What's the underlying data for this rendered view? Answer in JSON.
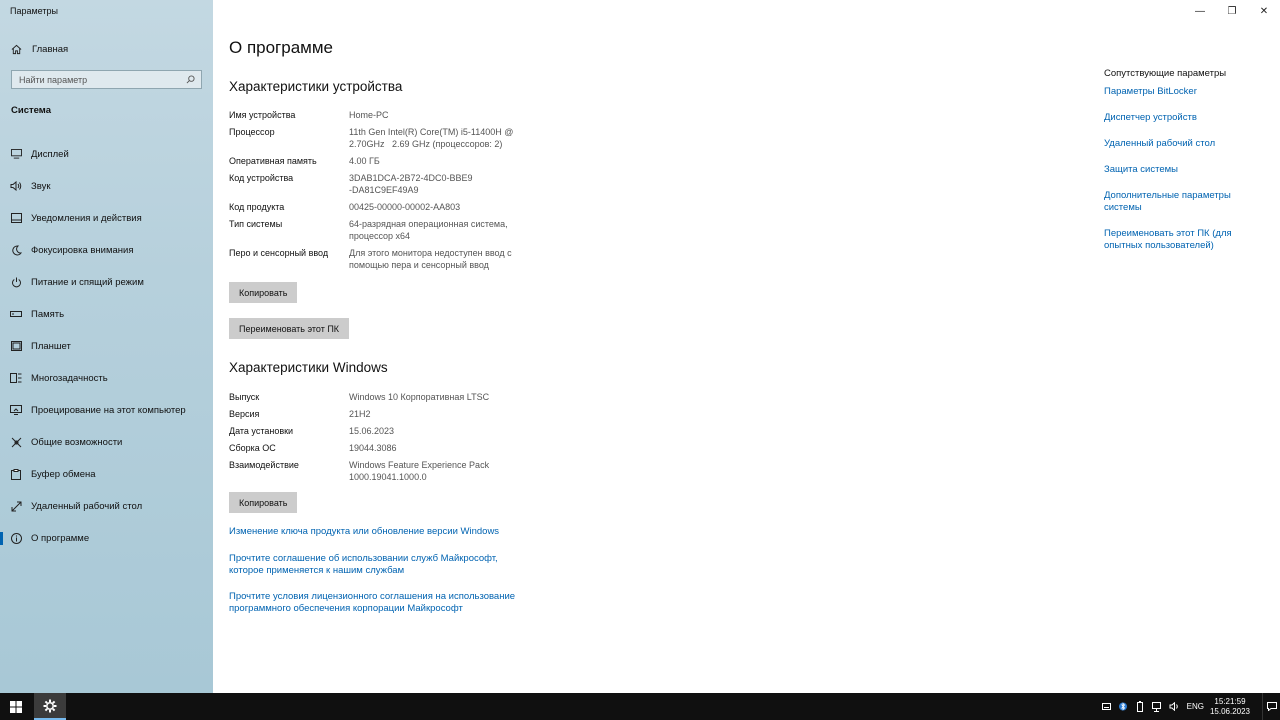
{
  "window": {
    "title": "Параметры",
    "minimize_glyph": "—",
    "restore_glyph": "❐",
    "close_glyph": "✕"
  },
  "sidebar": {
    "home_label": "Главная",
    "search_placeholder": "Найти параметр",
    "section_label": "Система",
    "items": [
      {
        "label": "Дисплей",
        "icon": "display-icon"
      },
      {
        "label": "Звук",
        "icon": "speaker-icon"
      },
      {
        "label": "Уведомления и действия",
        "icon": "notifications-icon"
      },
      {
        "label": "Фокусировка внимания",
        "icon": "moon-icon"
      },
      {
        "label": "Питание и спящий режим",
        "icon": "power-icon"
      },
      {
        "label": "Память",
        "icon": "storage-icon"
      },
      {
        "label": "Планшет",
        "icon": "tablet-icon"
      },
      {
        "label": "Многозадачность",
        "icon": "multitasking-icon"
      },
      {
        "label": "Проецирование на этот компьютер",
        "icon": "projecting-icon"
      },
      {
        "label": "Общие возможности",
        "icon": "shared-experiences-icon"
      },
      {
        "label": "Буфер обмена",
        "icon": "clipboard-icon"
      },
      {
        "label": "Удаленный рабочий стол",
        "icon": "remote-desktop-icon"
      },
      {
        "label": "О программе",
        "icon": "info-icon",
        "active": true
      }
    ]
  },
  "main": {
    "page_title": "О программе",
    "device_specs": {
      "heading": "Характеристики устройства",
      "rows": [
        {
          "key": "Имя устройства",
          "value": "Home-PC"
        },
        {
          "key": "Процессор",
          "value": "11th Gen Intel(R) Core(TM) i5-11400H @ 2.70GHz   2.69 GHz (процессоров: 2)"
        },
        {
          "key": "Оперативная память",
          "value": "4.00 ГБ"
        },
        {
          "key": "Код устройства",
          "value": "3DAB1DCA-2B72-4DC0-BBE9-DA81C9EF49A9"
        },
        {
          "key": "Код продукта",
          "value": "00425-00000-00002-AA803"
        },
        {
          "key": "Тип системы",
          "value": "64-разрядная операционная система, процессор x64"
        },
        {
          "key": "Перо и сенсорный ввод",
          "value": "Для этого монитора недоступен ввод с помощью пера и сенсорный ввод"
        }
      ],
      "copy_button": "Копировать",
      "rename_button": "Переименовать этот ПК"
    },
    "windows_specs": {
      "heading": "Характеристики Windows",
      "rows": [
        {
          "key": "Выпуск",
          "value": "Windows 10 Корпоративная LTSC"
        },
        {
          "key": "Версия",
          "value": "21H2"
        },
        {
          "key": "Дата установки",
          "value": "15.06.2023"
        },
        {
          "key": "Сборка ОС",
          "value": "19044.3086"
        },
        {
          "key": "Взаимодействие",
          "value": "Windows Feature Experience Pack 1000.19041.1000.0"
        }
      ],
      "copy_button": "Копировать"
    },
    "links": [
      "Изменение ключа продукта или обновление версии Windows",
      "Прочтите соглашение об использовании служб Майкрософт, которое применяется к нашим службам",
      "Прочтите условия лицензионного соглашения на использование программного обеспечения корпорации Майкрософт"
    ]
  },
  "related": {
    "title": "Сопутствующие параметры",
    "links": [
      "Параметры BitLocker",
      "Диспетчер устройств",
      "Удаленный рабочий стол",
      "Защита системы",
      "Дополнительные параметры системы",
      "Переименовать этот ПК (для опытных пользователей)"
    ]
  },
  "taskbar": {
    "language": "ENG",
    "time": "15:21:59",
    "date": "15.06.2023",
    "tray_icons": [
      "keyboard-icon",
      "bluetooth-icon",
      "battery-icon",
      "network-icon",
      "volume-icon"
    ]
  },
  "colors": {
    "accent": "#0063b1",
    "taskbar": "#101010",
    "sidebar": "#b6d0dc",
    "button": "#cccccc"
  }
}
